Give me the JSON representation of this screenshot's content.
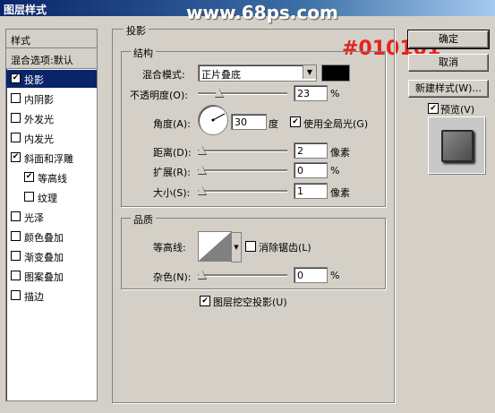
{
  "window": {
    "title": "图层样式"
  },
  "watermark": "www.68ps.com",
  "annotation": "#010101",
  "left_panel": {
    "header": "样式",
    "blend_options": "混合选项:默认",
    "items": [
      {
        "label": "投影",
        "checked": true,
        "selected": true
      },
      {
        "label": "内阴影",
        "checked": false
      },
      {
        "label": "外发光",
        "checked": false
      },
      {
        "label": "内发光",
        "checked": false
      },
      {
        "label": "斜面和浮雕",
        "checked": true
      },
      {
        "label": "等高线",
        "checked": true,
        "indent": true
      },
      {
        "label": "纹理",
        "checked": false,
        "indent": true
      },
      {
        "label": "光泽",
        "checked": false
      },
      {
        "label": "颜色叠加",
        "checked": false
      },
      {
        "label": "渐变叠加",
        "checked": false
      },
      {
        "label": "图案叠加",
        "checked": false
      },
      {
        "label": "描边",
        "checked": false
      }
    ]
  },
  "buttons": {
    "ok": "确定",
    "cancel": "取消",
    "new_style": "新建样式(W)...",
    "preview": "预览(V)"
  },
  "shadow": {
    "section_title": "投影",
    "structure_title": "结构",
    "blend_mode_label": "混合模式:",
    "blend_mode_value": "正片叠底",
    "shadow_color": "#000000",
    "opacity_label": "不透明度(O):",
    "opacity_value": "23",
    "opacity_unit": "%",
    "angle_label": "角度(A):",
    "angle_value": "30",
    "angle_unit": "度",
    "global_light_label": "使用全局光(G)",
    "distance_label": "距离(D):",
    "distance_value": "2",
    "distance_unit": "像素",
    "spread_label": "扩展(R):",
    "spread_value": "0",
    "spread_unit": "%",
    "size_label": "大小(S):",
    "size_value": "1",
    "size_unit": "像素"
  },
  "quality": {
    "title": "品质",
    "contour_label": "等高线:",
    "antialias_label": "消除锯齿(L)",
    "noise_label": "杂色(N):",
    "noise_value": "0",
    "noise_unit": "%"
  },
  "knockout_label": "图层挖空投影(U)"
}
